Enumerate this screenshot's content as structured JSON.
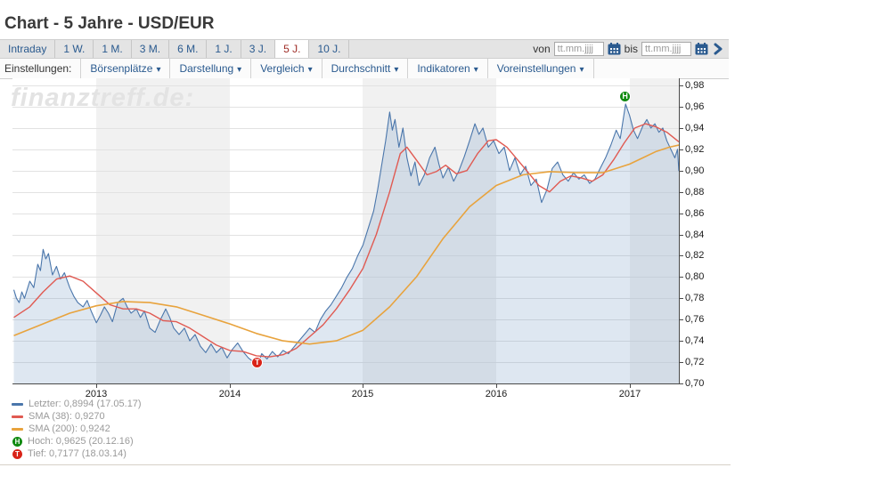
{
  "header": {
    "title": "Chart - 5 Jahre - USD/EUR"
  },
  "toolbar": {
    "periods": [
      {
        "label": "Intraday",
        "active": false
      },
      {
        "label": "1 W.",
        "active": false
      },
      {
        "label": "1 M.",
        "active": false
      },
      {
        "label": "3 M.",
        "active": false
      },
      {
        "label": "6 M.",
        "active": false
      },
      {
        "label": "1 J.",
        "active": false
      },
      {
        "label": "3 J.",
        "active": false
      },
      {
        "label": "5 J.",
        "active": true
      },
      {
        "label": "10 J.",
        "active": false
      }
    ],
    "von_label": "von",
    "bis_label": "bis",
    "date_placeholder": "tt.mm.jjjj"
  },
  "settings": {
    "label": "Einstellungen:",
    "dropdowns": [
      "Börsenplätze",
      "Darstellung",
      "Vergleich",
      "Durchschnitt",
      "Indikatoren",
      "Voreinstellungen"
    ]
  },
  "watermark": "finanztreff.de:",
  "colors": {
    "price": "#4a76ab",
    "price_fill": "rgba(105,145,190,0.22)",
    "sma38": "#e05a52",
    "sma200": "#e8a33d",
    "high_badge": "#108a10",
    "low_badge": "#d92318",
    "accent_blue": "#2a5a8f",
    "active_red": "#9e2b25"
  },
  "legend": [
    {
      "type": "line",
      "color": "#4a76ab",
      "text": "Letzter: 0,8994 (17.05.17)"
    },
    {
      "type": "line",
      "color": "#e05a52",
      "text": "SMA (38): 0,9270"
    },
    {
      "type": "line",
      "color": "#e8a33d",
      "text": "SMA (200): 0,9242"
    },
    {
      "type": "badge",
      "color": "#108a10",
      "letter": "H",
      "text": "Hoch: 0,9625 (20.12.16)"
    },
    {
      "type": "badge",
      "color": "#d92318",
      "letter": "T",
      "text": "Tief: 0,7177 (18.03.14)"
    }
  ],
  "chart_data": {
    "type": "line",
    "title": "USD/EUR 5 Jahre",
    "x_start": 2012.37,
    "x_end": 2017.37,
    "ylim": [
      0.7,
      0.98
    ],
    "grid": true,
    "legend_position": "bottom-left",
    "yticks": [
      [
        0.98,
        "0,98"
      ],
      [
        0.96,
        "0,96"
      ],
      [
        0.94,
        "0,94"
      ],
      [
        0.92,
        "0,92"
      ],
      [
        0.9,
        "0,90"
      ],
      [
        0.88,
        "0,88"
      ],
      [
        0.86,
        "0,86"
      ],
      [
        0.84,
        "0,84"
      ],
      [
        0.82,
        "0,82"
      ],
      [
        0.8,
        "0,80"
      ],
      [
        0.78,
        "0,78"
      ],
      [
        0.76,
        "0,76"
      ],
      [
        0.74,
        "0,74"
      ],
      [
        0.72,
        "0,72"
      ],
      [
        0.7,
        "0,70"
      ]
    ],
    "xticks": [
      [
        2013,
        "2013"
      ],
      [
        2014,
        "2014"
      ],
      [
        2015,
        "2015"
      ],
      [
        2016,
        "2016"
      ],
      [
        2017,
        "2017"
      ]
    ],
    "shaded_year_bands": [
      [
        2013,
        2014
      ],
      [
        2015,
        2016
      ],
      [
        2017,
        2017.37
      ]
    ],
    "series": [
      {
        "name": "Letzter",
        "color": "#4a76ab",
        "width": 1.1,
        "fill": true,
        "points": [
          [
            2012.38,
            0.788
          ],
          [
            2012.4,
            0.78
          ],
          [
            2012.42,
            0.776
          ],
          [
            2012.44,
            0.786
          ],
          [
            2012.46,
            0.78
          ],
          [
            2012.5,
            0.796
          ],
          [
            2012.53,
            0.79
          ],
          [
            2012.56,
            0.812
          ],
          [
            2012.58,
            0.806
          ],
          [
            2012.6,
            0.826
          ],
          [
            2012.62,
            0.817
          ],
          [
            2012.64,
            0.822
          ],
          [
            2012.67,
            0.802
          ],
          [
            2012.7,
            0.81
          ],
          [
            2012.73,
            0.798
          ],
          [
            2012.76,
            0.804
          ],
          [
            2012.8,
            0.79
          ],
          [
            2012.83,
            0.782
          ],
          [
            2012.86,
            0.776
          ],
          [
            2012.9,
            0.772
          ],
          [
            2012.93,
            0.778
          ],
          [
            2012.96,
            0.768
          ],
          [
            2013.0,
            0.757
          ],
          [
            2013.03,
            0.764
          ],
          [
            2013.06,
            0.772
          ],
          [
            2013.09,
            0.766
          ],
          [
            2013.12,
            0.758
          ],
          [
            2013.16,
            0.776
          ],
          [
            2013.2,
            0.78
          ],
          [
            2013.23,
            0.772
          ],
          [
            2013.26,
            0.766
          ],
          [
            2013.3,
            0.77
          ],
          [
            2013.33,
            0.762
          ],
          [
            2013.36,
            0.768
          ],
          [
            2013.4,
            0.752
          ],
          [
            2013.44,
            0.748
          ],
          [
            2013.48,
            0.76
          ],
          [
            2013.52,
            0.77
          ],
          [
            2013.55,
            0.762
          ],
          [
            2013.58,
            0.752
          ],
          [
            2013.62,
            0.746
          ],
          [
            2013.66,
            0.752
          ],
          [
            2013.7,
            0.74
          ],
          [
            2013.74,
            0.746
          ],
          [
            2013.78,
            0.735
          ],
          [
            2013.82,
            0.729
          ],
          [
            2013.86,
            0.737
          ],
          [
            2013.9,
            0.729
          ],
          [
            2013.94,
            0.734
          ],
          [
            2013.98,
            0.724
          ],
          [
            2014.02,
            0.732
          ],
          [
            2014.06,
            0.738
          ],
          [
            2014.1,
            0.73
          ],
          [
            2014.14,
            0.724
          ],
          [
            2014.18,
            0.72
          ],
          [
            2014.21,
            0.7177
          ],
          [
            2014.24,
            0.728
          ],
          [
            2014.28,
            0.723
          ],
          [
            2014.32,
            0.73
          ],
          [
            2014.36,
            0.725
          ],
          [
            2014.4,
            0.731
          ],
          [
            2014.44,
            0.728
          ],
          [
            2014.48,
            0.734
          ],
          [
            2014.52,
            0.74
          ],
          [
            2014.56,
            0.746
          ],
          [
            2014.6,
            0.752
          ],
          [
            2014.64,
            0.748
          ],
          [
            2014.68,
            0.76
          ],
          [
            2014.72,
            0.768
          ],
          [
            2014.76,
            0.774
          ],
          [
            2014.8,
            0.782
          ],
          [
            2014.84,
            0.79
          ],
          [
            2014.88,
            0.8
          ],
          [
            2014.92,
            0.808
          ],
          [
            2014.96,
            0.82
          ],
          [
            2015.0,
            0.83
          ],
          [
            2015.04,
            0.846
          ],
          [
            2015.08,
            0.862
          ],
          [
            2015.11,
            0.882
          ],
          [
            2015.14,
            0.905
          ],
          [
            2015.17,
            0.928
          ],
          [
            2015.2,
            0.955
          ],
          [
            2015.22,
            0.938
          ],
          [
            2015.24,
            0.948
          ],
          [
            2015.27,
            0.922
          ],
          [
            2015.3,
            0.94
          ],
          [
            2015.33,
            0.912
          ],
          [
            2015.36,
            0.895
          ],
          [
            2015.39,
            0.908
          ],
          [
            2015.42,
            0.886
          ],
          [
            2015.46,
            0.896
          ],
          [
            2015.5,
            0.912
          ],
          [
            2015.54,
            0.922
          ],
          [
            2015.57,
            0.906
          ],
          [
            2015.6,
            0.893
          ],
          [
            2015.64,
            0.903
          ],
          [
            2015.68,
            0.89
          ],
          [
            2015.72,
            0.9
          ],
          [
            2015.76,
            0.913
          ],
          [
            2015.8,
            0.928
          ],
          [
            2015.84,
            0.944
          ],
          [
            2015.87,
            0.934
          ],
          [
            2015.9,
            0.94
          ],
          [
            2015.94,
            0.922
          ],
          [
            2015.98,
            0.928
          ],
          [
            2016.02,
            0.916
          ],
          [
            2016.06,
            0.922
          ],
          [
            2016.1,
            0.9
          ],
          [
            2016.14,
            0.912
          ],
          [
            2016.18,
            0.896
          ],
          [
            2016.22,
            0.904
          ],
          [
            2016.26,
            0.886
          ],
          [
            2016.3,
            0.892
          ],
          [
            2016.34,
            0.87
          ],
          [
            2016.38,
            0.882
          ],
          [
            2016.42,
            0.902
          ],
          [
            2016.46,
            0.908
          ],
          [
            2016.5,
            0.896
          ],
          [
            2016.54,
            0.89
          ],
          [
            2016.58,
            0.898
          ],
          [
            2016.62,
            0.892
          ],
          [
            2016.66,
            0.896
          ],
          [
            2016.7,
            0.888
          ],
          [
            2016.74,
            0.892
          ],
          [
            2016.78,
            0.902
          ],
          [
            2016.82,
            0.912
          ],
          [
            2016.86,
            0.924
          ],
          [
            2016.9,
            0.938
          ],
          [
            2016.93,
            0.93
          ],
          [
            2016.97,
            0.9625
          ],
          [
            2017.0,
            0.952
          ],
          [
            2017.03,
            0.938
          ],
          [
            2017.06,
            0.93
          ],
          [
            2017.1,
            0.942
          ],
          [
            2017.13,
            0.948
          ],
          [
            2017.16,
            0.94
          ],
          [
            2017.19,
            0.944
          ],
          [
            2017.22,
            0.936
          ],
          [
            2017.25,
            0.94
          ],
          [
            2017.28,
            0.928
          ],
          [
            2017.31,
            0.92
          ],
          [
            2017.34,
            0.912
          ],
          [
            2017.36,
            0.92
          ],
          [
            2017.37,
            0.8994
          ]
        ]
      },
      {
        "name": "SMA (38)",
        "color": "#e05a52",
        "width": 1.4,
        "fill": false,
        "points": [
          [
            2012.38,
            0.762
          ],
          [
            2012.5,
            0.772
          ],
          [
            2012.6,
            0.786
          ],
          [
            2012.7,
            0.798
          ],
          [
            2012.8,
            0.801
          ],
          [
            2012.9,
            0.796
          ],
          [
            2013.0,
            0.785
          ],
          [
            2013.1,
            0.774
          ],
          [
            2013.2,
            0.77
          ],
          [
            2013.3,
            0.77
          ],
          [
            2013.4,
            0.766
          ],
          [
            2013.5,
            0.759
          ],
          [
            2013.6,
            0.758
          ],
          [
            2013.7,
            0.752
          ],
          [
            2013.8,
            0.744
          ],
          [
            2013.9,
            0.736
          ],
          [
            2014.0,
            0.731
          ],
          [
            2014.1,
            0.73
          ],
          [
            2014.2,
            0.726
          ],
          [
            2014.3,
            0.725
          ],
          [
            2014.4,
            0.727
          ],
          [
            2014.5,
            0.733
          ],
          [
            2014.6,
            0.744
          ],
          [
            2014.7,
            0.755
          ],
          [
            2014.8,
            0.77
          ],
          [
            2014.9,
            0.788
          ],
          [
            2015.0,
            0.808
          ],
          [
            2015.1,
            0.84
          ],
          [
            2015.2,
            0.88
          ],
          [
            2015.28,
            0.916
          ],
          [
            2015.33,
            0.922
          ],
          [
            2015.4,
            0.91
          ],
          [
            2015.48,
            0.896
          ],
          [
            2015.55,
            0.899
          ],
          [
            2015.62,
            0.905
          ],
          [
            2015.7,
            0.897
          ],
          [
            2015.78,
            0.9
          ],
          [
            2015.86,
            0.916
          ],
          [
            2015.94,
            0.928
          ],
          [
            2016.0,
            0.929
          ],
          [
            2016.08,
            0.922
          ],
          [
            2016.16,
            0.91
          ],
          [
            2016.24,
            0.898
          ],
          [
            2016.32,
            0.886
          ],
          [
            2016.4,
            0.88
          ],
          [
            2016.48,
            0.89
          ],
          [
            2016.56,
            0.895
          ],
          [
            2016.64,
            0.893
          ],
          [
            2016.72,
            0.89
          ],
          [
            2016.8,
            0.896
          ],
          [
            2016.88,
            0.91
          ],
          [
            2016.96,
            0.926
          ],
          [
            2017.04,
            0.94
          ],
          [
            2017.12,
            0.944
          ],
          [
            2017.2,
            0.941
          ],
          [
            2017.28,
            0.936
          ],
          [
            2017.37,
            0.927
          ]
        ]
      },
      {
        "name": "SMA (200)",
        "color": "#e8a33d",
        "width": 1.6,
        "fill": false,
        "points": [
          [
            2012.38,
            0.745
          ],
          [
            2012.6,
            0.756
          ],
          [
            2012.8,
            0.766
          ],
          [
            2013.0,
            0.773
          ],
          [
            2013.2,
            0.777
          ],
          [
            2013.4,
            0.776
          ],
          [
            2013.6,
            0.772
          ],
          [
            2013.8,
            0.764
          ],
          [
            2014.0,
            0.756
          ],
          [
            2014.2,
            0.747
          ],
          [
            2014.4,
            0.74
          ],
          [
            2014.6,
            0.737
          ],
          [
            2014.8,
            0.74
          ],
          [
            2015.0,
            0.75
          ],
          [
            2015.2,
            0.772
          ],
          [
            2015.4,
            0.8
          ],
          [
            2015.6,
            0.836
          ],
          [
            2015.8,
            0.866
          ],
          [
            2016.0,
            0.886
          ],
          [
            2016.2,
            0.896
          ],
          [
            2016.4,
            0.899
          ],
          [
            2016.6,
            0.898
          ],
          [
            2016.8,
            0.898
          ],
          [
            2017.0,
            0.906
          ],
          [
            2017.1,
            0.912
          ],
          [
            2017.2,
            0.918
          ],
          [
            2017.3,
            0.922
          ],
          [
            2017.37,
            0.924
          ]
        ]
      }
    ],
    "markers": [
      {
        "letter": "H",
        "color": "#108a10",
        "x": 2016.97,
        "value": 0.9625,
        "dy": -8,
        "label": "Hoch 0,9625 20.12.16"
      },
      {
        "letter": "T",
        "color": "#d92318",
        "x": 2014.21,
        "value": 0.7177,
        "dy": -2,
        "label": "Tief 0,7177 18.03.14"
      }
    ]
  }
}
